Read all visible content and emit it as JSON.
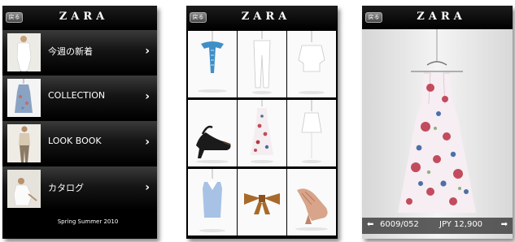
{
  "brand": "ZARA",
  "back_label": "戻る",
  "menu": {
    "items": [
      {
        "label": "今週の新着"
      },
      {
        "label": "COLLECTION"
      },
      {
        "label": "LOOK BOOK"
      },
      {
        "label": "カタログ"
      }
    ],
    "chevron": "›",
    "season": "Spring Summer 2010"
  },
  "grid": {
    "items": [
      {
        "icon": "blue-scarf-icon"
      },
      {
        "icon": "white-trousers-icon"
      },
      {
        "icon": "white-blouse-icon"
      },
      {
        "icon": "black-slingback-shoe-icon"
      },
      {
        "icon": "floral-dress-icon"
      },
      {
        "icon": "white-skirt-icon"
      },
      {
        "icon": "blue-dress-icon"
      },
      {
        "icon": "brown-bow-belt-icon"
      },
      {
        "icon": "tan-platform-sandal-icon"
      }
    ]
  },
  "detail": {
    "product_code": "6009/052",
    "price": "JPY 12,900",
    "prev_arrow": "⬅",
    "next_arrow": "➡"
  }
}
